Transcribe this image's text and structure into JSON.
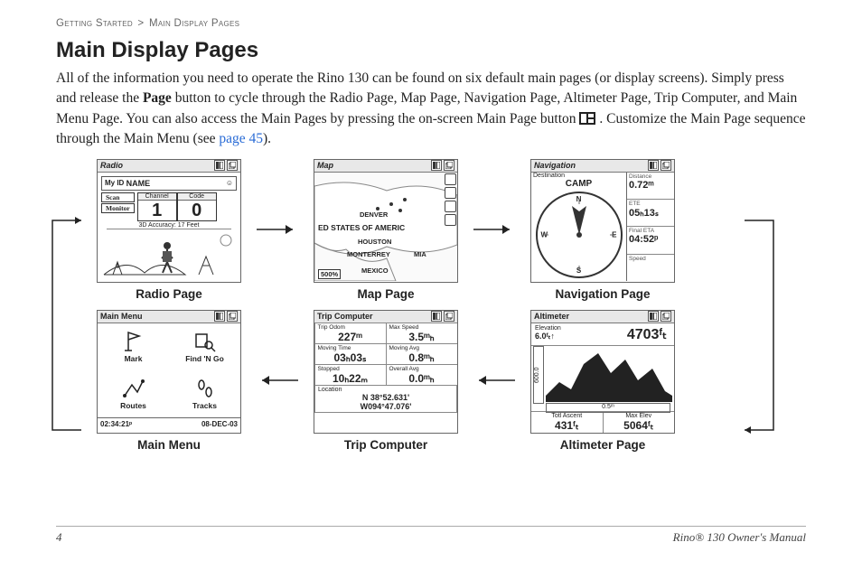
{
  "breadcrumb": {
    "section": "Getting Started",
    "sub": "Main Display Pages"
  },
  "heading": "Main Display Pages",
  "paragraph": {
    "p1a": "All of the information you need to operate the Rino 130 can be found on six default main pages (or display screens). Simply press and release the ",
    "p1b": "Page",
    "p1c": " button to cycle through the Radio Page, Map Page, Navigation Page, Altimeter Page, Trip Computer, and Main Menu Page. You can also access the Main Pages by pressing the on-screen Main Page button ",
    "p1d": ". Customize the Main Page sequence through the Main Menu (see ",
    "link": "page 45",
    "p1e": ")."
  },
  "captions": {
    "radio": "Radio Page",
    "map": "Map Page",
    "nav": "Navigation Page",
    "menu": "Main Menu",
    "trip": "Trip Computer",
    "alt": "Altimeter Page"
  },
  "radio": {
    "title": "Radio",
    "myid_label": "My ID",
    "myid_value": "NAME",
    "scan": "Scan",
    "monitor": "Monitor",
    "channel_label": "Channel",
    "code_label": "Code",
    "channel": "1",
    "code": "0",
    "accuracy": "3D Accuracy: 17 Feet"
  },
  "map": {
    "title": "Map",
    "labels": {
      "denver": "DENVER",
      "us": "ED STATES OF AMERIC",
      "houston": "HOUSTON",
      "monterrey": "MONTERREY",
      "miami": "MIA",
      "mexico": "MEXICO",
      "scale": "500%"
    }
  },
  "nav": {
    "title": "Navigation",
    "dest_label": "Destination",
    "dest": "CAMP",
    "fields": [
      {
        "label": "Distance",
        "value": "0.72ᵐ"
      },
      {
        "label": "ETE",
        "value": "05ₕ13ₛ"
      },
      {
        "label": "Final ETA",
        "value": "04:52ᵖ"
      },
      {
        "label": "Speed",
        "value": ""
      }
    ],
    "cardinals": {
      "n": "N",
      "s": "S",
      "e": "E",
      "w": "W"
    }
  },
  "alt": {
    "title": "Altimeter",
    "elev_label": "Elevation",
    "elev_delta": "6.0ᶠₜ↑",
    "elev": "4703ᶠₜ",
    "yscale": "600.0",
    "xscale": "0.5ᵐ",
    "ascent_label": "Totl Ascent",
    "ascent": "431ᶠₜ",
    "maxelev_label": "Max Elev",
    "maxelev": "5064ᶠₜ"
  },
  "trip": {
    "title": "Trip Computer",
    "cells": [
      {
        "label": "Trip Odom",
        "value": "227ᵐ"
      },
      {
        "label": "Max Speed",
        "value": "3.5ᵐₕ"
      },
      {
        "label": "Moving Time",
        "value": "03ₕ03ₛ"
      },
      {
        "label": "Moving Avg",
        "value": "0.8ᵐₕ"
      },
      {
        "label": "Stopped",
        "value": "10ₕ22ₘ"
      },
      {
        "label": "Overall Avg",
        "value": "0.0ᵐₕ"
      }
    ],
    "loc_label": "Location",
    "loc": "N 38°52.631'\nW094°47.076'"
  },
  "menu": {
    "title": "Main Menu",
    "items": [
      "Mark",
      "Find 'N Go",
      "Routes",
      "Tracks"
    ],
    "time": "02:34:21ᵖ",
    "date": "08-DEC-03"
  },
  "footer": {
    "page": "4",
    "doc": "Rino® 130 Owner's Manual"
  }
}
